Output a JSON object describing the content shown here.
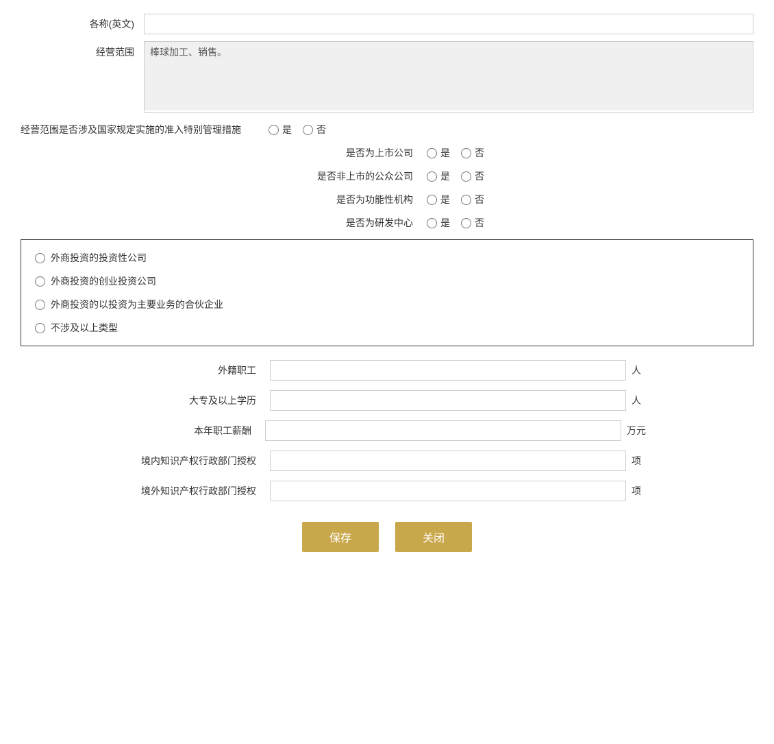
{
  "form": {
    "name_en_label": "各称(英文)",
    "name_en_placeholder": "",
    "name_en_value": "",
    "business_scope_label": "经营范围",
    "business_scope_value": "棒球加工、销售。",
    "special_management_label": "经营范围是否涉及国家规定实施的准入特别管理措施",
    "special_management_yes": "是",
    "special_management_no": "否",
    "listed_company_label": "是否为上市公司",
    "listed_yes": "是",
    "listed_no": "否",
    "non_listed_public_label": "是否非上市的公众公司",
    "non_listed_public_yes": "是",
    "non_listed_public_no": "否",
    "functional_org_label": "是否为功能性机构",
    "functional_yes": "是",
    "functional_no": "否",
    "rd_center_label": "是否为研发中心",
    "rd_yes": "是",
    "rd_no": "否",
    "box_options": [
      "外商投资的投资性公司",
      "外商投资的创业投资公司",
      "外商投资的以投资为主要业务的合伙企业",
      "不涉及以上类型"
    ],
    "foreign_workers_label": "外籍职工",
    "foreign_workers_value": "",
    "foreign_workers_unit": "人",
    "college_edu_label": "大专及以上学历",
    "college_edu_value": "",
    "college_edu_unit": "人",
    "annual_salary_label": "本年职工薪酬",
    "annual_salary_value": "",
    "annual_salary_unit": "万元",
    "domestic_ip_label": "境内知识产权行政部门授权",
    "domestic_ip_value": "",
    "domestic_ip_unit": "项",
    "foreign_ip_label": "境外知识产权行政部门授权",
    "foreign_ip_value": "",
    "foreign_ip_unit": "项",
    "save_button": "保存",
    "close_button": "关闭"
  }
}
